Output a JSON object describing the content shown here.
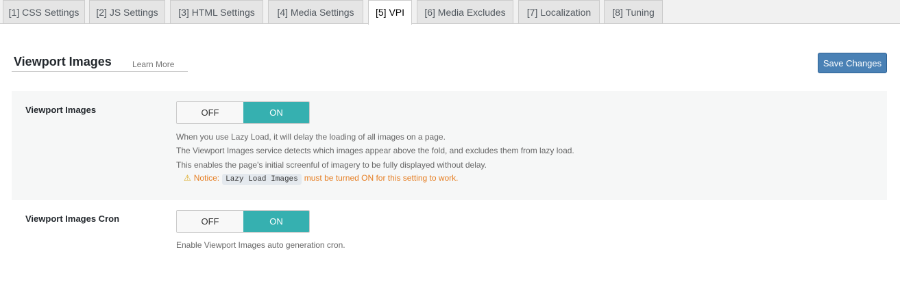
{
  "tabs": [
    {
      "label": "[1] CSS Settings"
    },
    {
      "label": "[2] JS Settings"
    },
    {
      "label": "[3] HTML Settings"
    },
    {
      "label": "[4] Media Settings"
    },
    {
      "label": "[5] VPI"
    },
    {
      "label": "[6] Media Excludes"
    },
    {
      "label": "[7] Localization"
    },
    {
      "label": "[8] Tuning"
    }
  ],
  "active_tab": "[5] VPI",
  "section": {
    "title": "Viewport Images",
    "learn_more": "Learn More",
    "save_label": "Save Changes"
  },
  "settings": [
    {
      "label": "Viewport Images",
      "toggle": {
        "off": "OFF",
        "on": "ON",
        "value": "ON"
      },
      "description": [
        "When you use Lazy Load, it will delay the loading of all images on a page.",
        "The Viewport Images service detects which images appear above the fold, and excludes them from lazy load.",
        "This enables the page's initial screenful of imagery to be fully displayed without delay."
      ],
      "notice": {
        "prefix": "Notice:",
        "code": "Lazy Load Images",
        "suffix": "must be turned ON for this setting to work."
      }
    },
    {
      "label": "Viewport Images Cron",
      "toggle": {
        "off": "OFF",
        "on": "ON",
        "value": "ON"
      },
      "description": [
        "Enable Viewport Images auto generation cron."
      ]
    }
  ],
  "colors": {
    "toggle_on": "#36b0b0",
    "save_button": "#4a81b5",
    "notice": "#e67e22"
  },
  "icons": {
    "notice": "warning-icon"
  }
}
